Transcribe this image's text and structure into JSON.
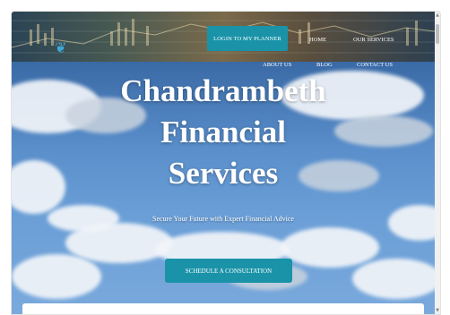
{
  "header": {
    "login_button": "LOGIN TO MY PLANNER",
    "nav": [
      "HOME",
      "OUR SERVICES",
      "ABOUT US",
      "BLOG",
      "CONTACT US"
    ],
    "logo_icon": "leaf-logo-icon"
  },
  "hero": {
    "title_lines": [
      "Chandrambeth",
      "Financial",
      "Services"
    ],
    "subtitle": "Secure Your Future with Expert Financial Advice",
    "cta_label": "SCHEDULE A CONSULTATION"
  },
  "colors": {
    "accent": "#1a93a8",
    "text_on_hero": "#ffffff",
    "sky": "#5a8fcb"
  }
}
